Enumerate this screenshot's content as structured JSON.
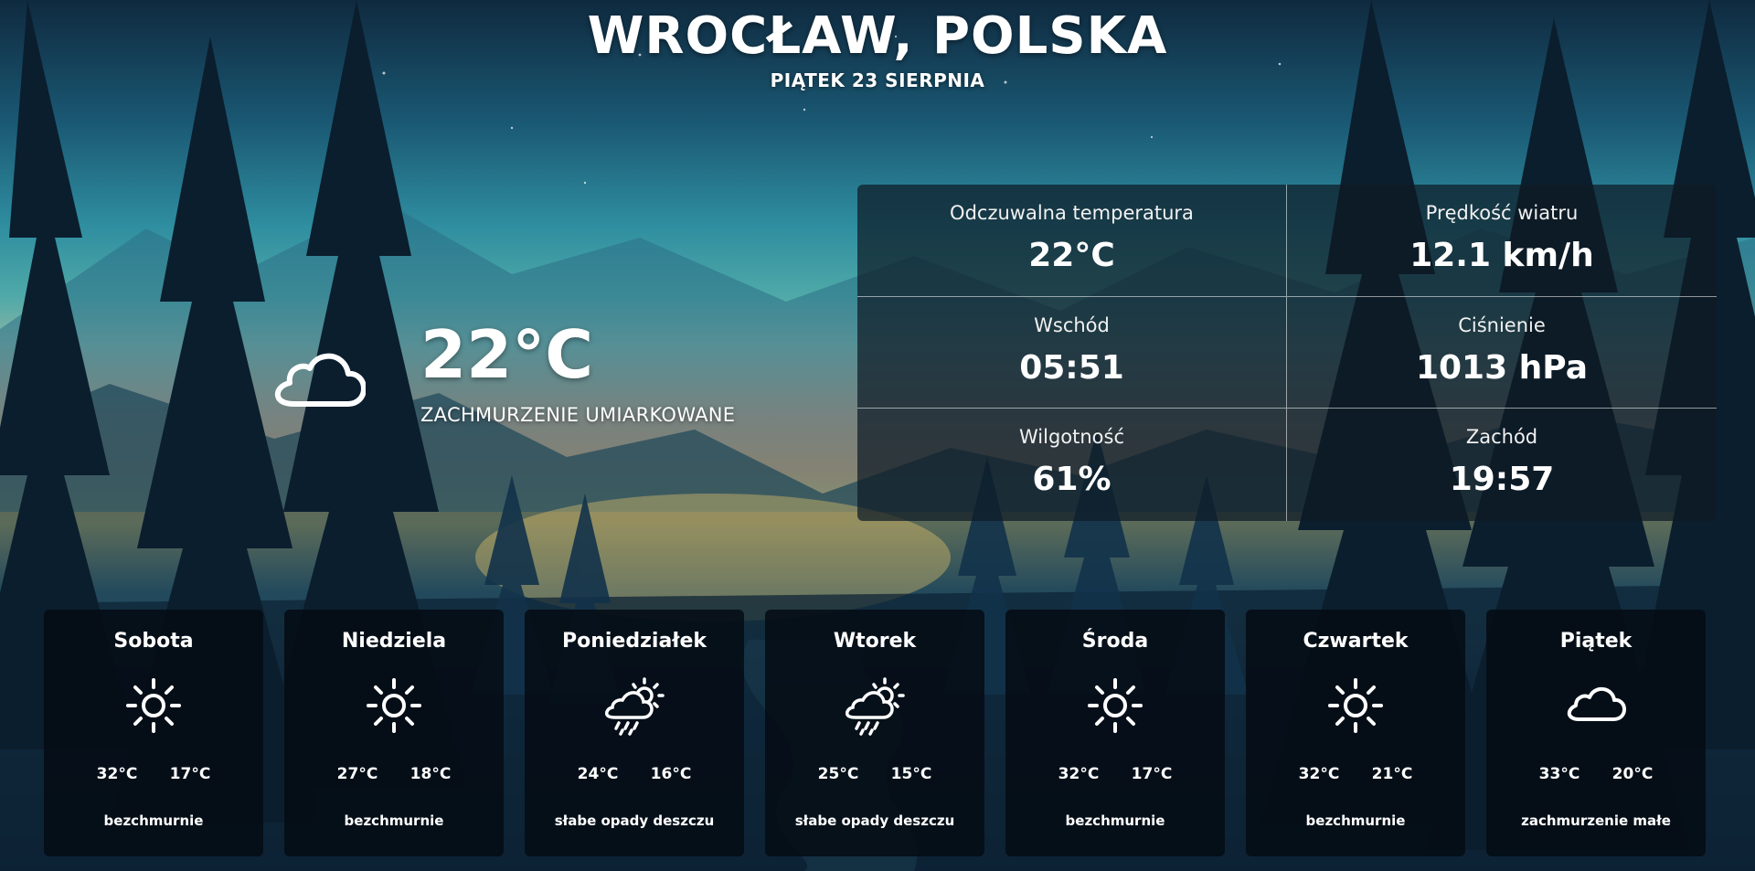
{
  "header": {
    "city": "WROCŁAW, POLSKA",
    "date": "PIĄTEK 23 SIERPNIA"
  },
  "current": {
    "icon": "cloud-icon",
    "temperature": "22°C",
    "description": "ZACHMURZENIE UMIARKOWANE"
  },
  "details": [
    {
      "label": "Odczuwalna temperatura",
      "value": "22°C"
    },
    {
      "label": "Prędkość wiatru",
      "value": "12.1 km/h"
    },
    {
      "label": "Wschód",
      "value": "05:51"
    },
    {
      "label": "Ciśnienie",
      "value": "1013 hPa"
    },
    {
      "label": "Wilgotność",
      "value": "61%"
    },
    {
      "label": "Zachód",
      "value": "19:57"
    }
  ],
  "forecast": [
    {
      "day": "Sobota",
      "icon": "sun-icon",
      "max": "32°C",
      "min": "17°C",
      "desc": "bezchmurnie"
    },
    {
      "day": "Niedziela",
      "icon": "sun-icon",
      "max": "27°C",
      "min": "18°C",
      "desc": "bezchmurnie"
    },
    {
      "day": "Poniedziałek",
      "icon": "sun-cloud-rain-icon",
      "max": "24°C",
      "min": "16°C",
      "desc": "słabe opady deszczu"
    },
    {
      "day": "Wtorek",
      "icon": "sun-cloud-rain-icon",
      "max": "25°C",
      "min": "15°C",
      "desc": "słabe opady deszczu"
    },
    {
      "day": "Środa",
      "icon": "sun-icon",
      "max": "32°C",
      "min": "17°C",
      "desc": "bezchmurnie"
    },
    {
      "day": "Czwartek",
      "icon": "sun-icon",
      "max": "32°C",
      "min": "21°C",
      "desc": "bezchmurnie"
    },
    {
      "day": "Piątek",
      "icon": "cloud-icon",
      "max": "33°C",
      "min": "20°C",
      "desc": "zachmurzenie małe"
    }
  ]
}
